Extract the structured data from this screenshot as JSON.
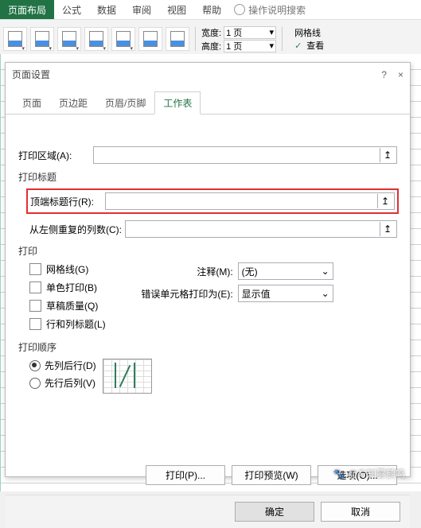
{
  "ribbon": {
    "tabs": [
      "页面布局",
      "公式",
      "数据",
      "审阅",
      "视图",
      "帮助"
    ],
    "active_tab": "页面布局",
    "tell_me": "操作说明搜索",
    "size_group": {
      "width_label": "宽度:",
      "width_value": "1 页",
      "height_label": "高度:",
      "height_value": "1 页"
    },
    "gridlines_label": "网格线",
    "view_check": "查看"
  },
  "dialog": {
    "title": "页面设置",
    "help_icon": "?",
    "close_icon": "×",
    "tabs": {
      "page": "页面",
      "margins": "页边距",
      "headerFooter": "页眉/页脚",
      "sheet": "工作表"
    },
    "print_area_label": "打印区域(A):",
    "print_titles_label": "打印标题",
    "rows_repeat_label": "顶端标题行(R):",
    "cols_repeat_label": "从左侧重复的列数(C):",
    "print_section": "打印",
    "checks": {
      "gridlines": "网格线(G)",
      "bw": "单色打印(B)",
      "draft": "草稿质量(Q)",
      "rowcol": "行和列标题(L)"
    },
    "comments_label": "注释(M):",
    "comments_value": "(无)",
    "errors_label": "错误单元格打印为(E):",
    "errors_value": "显示值",
    "order_section": "打印顺序",
    "order_down_over": "先列后行(D)",
    "order_over_down": "先行后列(V)",
    "buttons": {
      "print": "打印(P)...",
      "preview": "打印预览(W)",
      "options": "选项(O)..."
    },
    "ok": "确定",
    "cancel": "取消"
  },
  "watermark": "🐾 @方知雾鹤鸣"
}
